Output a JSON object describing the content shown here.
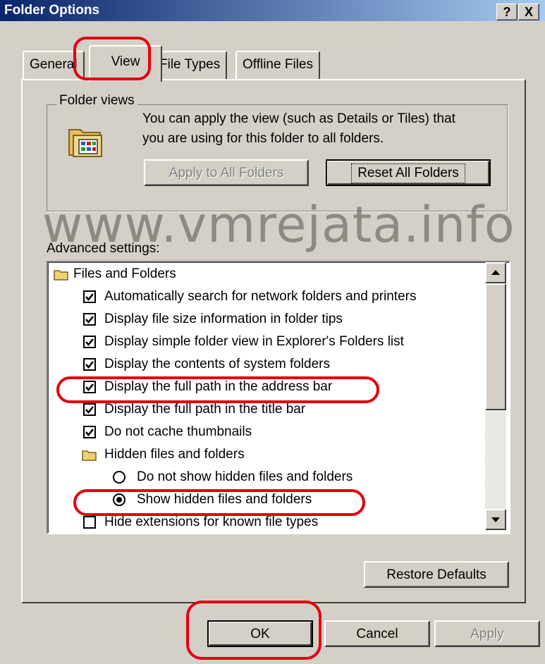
{
  "window": {
    "title": "Folder Options",
    "help_label": "?",
    "close_label": "X"
  },
  "tabs": [
    {
      "label": "General"
    },
    {
      "label": "View"
    },
    {
      "label": "File Types"
    },
    {
      "label": "Offline Files"
    }
  ],
  "active_tab": "View",
  "folder_views": {
    "legend": "Folder views",
    "description_line1": "You can apply the view (such as Details or Tiles) that",
    "description_line2": "you are using for this folder to all folders.",
    "apply_button": "Apply to All Folders",
    "reset_button": "Reset All Folders"
  },
  "watermark": "www.vmrejata.info",
  "advanced": {
    "label": "Advanced settings:",
    "items": [
      {
        "type": "folder",
        "label": "Files and Folders"
      },
      {
        "type": "checkbox",
        "checked": true,
        "label": "Automatically search for network folders and printers"
      },
      {
        "type": "checkbox",
        "checked": true,
        "label": "Display file size information in folder tips"
      },
      {
        "type": "checkbox",
        "checked": true,
        "label": "Display simple folder view in Explorer's Folders list"
      },
      {
        "type": "checkbox",
        "checked": true,
        "label": "Display the contents of system folders"
      },
      {
        "type": "checkbox",
        "checked": true,
        "label": "Display the full path in the address bar"
      },
      {
        "type": "checkbox",
        "checked": true,
        "label": "Display the full path in the title bar"
      },
      {
        "type": "checkbox",
        "checked": true,
        "label": "Do not cache thumbnails"
      },
      {
        "type": "folder",
        "label": "Hidden files and folders"
      },
      {
        "type": "radio",
        "checked": false,
        "label": "Do not show hidden files and folders"
      },
      {
        "type": "radio",
        "checked": true,
        "label": "Show hidden files and folders"
      },
      {
        "type": "checkbox",
        "checked": false,
        "label": "Hide extensions for known file types"
      }
    ]
  },
  "buttons": {
    "restore_defaults": "Restore Defaults",
    "ok": "OK",
    "cancel": "Cancel",
    "apply": "Apply"
  },
  "colors": {
    "highlight_ring": "#e3000f",
    "titlebar": "#0a246a"
  }
}
